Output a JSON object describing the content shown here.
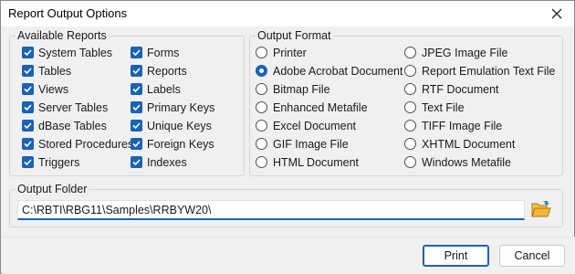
{
  "window": {
    "title": "Report Output Options"
  },
  "reports": {
    "label": "Available Reports",
    "col1": [
      {
        "label": "System Tables",
        "checked": true
      },
      {
        "label": "Tables",
        "checked": true
      },
      {
        "label": "Views",
        "checked": true
      },
      {
        "label": "Server Tables",
        "checked": true
      },
      {
        "label": "dBase Tables",
        "checked": true
      },
      {
        "label": "Stored Procedures",
        "checked": true
      },
      {
        "label": "Triggers",
        "checked": true
      }
    ],
    "col2": [
      {
        "label": "Forms",
        "checked": true
      },
      {
        "label": "Reports",
        "checked": true
      },
      {
        "label": "Labels",
        "checked": true
      },
      {
        "label": "Primary Keys",
        "checked": true
      },
      {
        "label": "Unique Keys",
        "checked": true
      },
      {
        "label": "Foreign Keys",
        "checked": true
      },
      {
        "label": "Indexes",
        "checked": true
      }
    ]
  },
  "format": {
    "label": "Output Format",
    "col1": [
      {
        "label": "Printer",
        "selected": false
      },
      {
        "label": "Adobe Acrobat Document",
        "selected": true
      },
      {
        "label": "Bitmap File",
        "selected": false
      },
      {
        "label": "Enhanced Metafile",
        "selected": false
      },
      {
        "label": "Excel Document",
        "selected": false
      },
      {
        "label": "GIF Image File",
        "selected": false
      },
      {
        "label": "HTML Document",
        "selected": false
      }
    ],
    "col2": [
      {
        "label": "JPEG Image File",
        "selected": false
      },
      {
        "label": "Report Emulation Text File",
        "selected": false
      },
      {
        "label": "RTF Document",
        "selected": false
      },
      {
        "label": "Text File",
        "selected": false
      },
      {
        "label": "TIFF Image File",
        "selected": false
      },
      {
        "label": "XHTML Document",
        "selected": false
      },
      {
        "label": "Windows Metafile",
        "selected": false
      }
    ]
  },
  "folder": {
    "label": "Output Folder",
    "value": "C:\\RBTI\\RBG11\\Samples\\RRBYW20\\"
  },
  "buttons": {
    "print": "Print",
    "cancel": "Cancel"
  },
  "colors": {
    "accent": "#1a62b5",
    "folder_icon": "#e8a820"
  }
}
